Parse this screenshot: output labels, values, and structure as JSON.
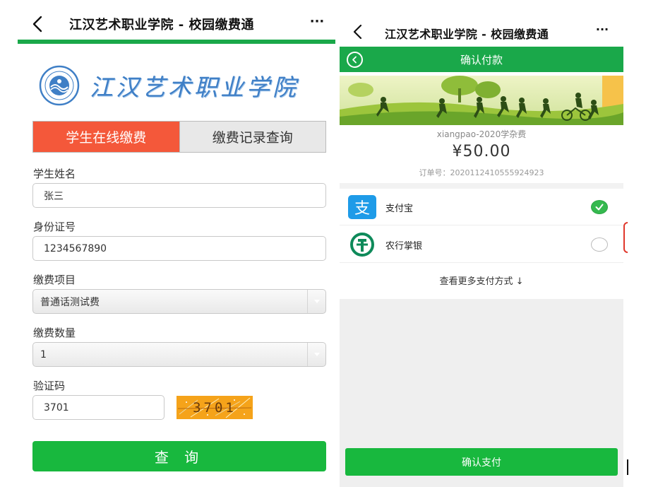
{
  "left": {
    "nav": {
      "title": "江汉艺术职业学院 - 校园缴费通",
      "more": "···"
    },
    "logo": {
      "text": "江汉艺术职业学院"
    },
    "tabs": [
      {
        "label": "学生在线缴费",
        "active": true
      },
      {
        "label": "缴费记录查询",
        "active": false
      }
    ],
    "form": {
      "name_label": "学生姓名",
      "name_value": "张三",
      "id_label": "身份证号",
      "id_value": "1234567890",
      "item_label": "缴费项目",
      "item_value": "普通话测试费",
      "qty_label": "缴费数量",
      "qty_value": "1",
      "captcha_label": "验证码",
      "captcha_value": "3701",
      "captcha_image_text": "3701"
    },
    "query_button": "查 询",
    "colors": {
      "accent_green": "#1aa84a",
      "active_tab": "#f4583a",
      "button_green": "#18b83e",
      "captcha_bg": "#f5a31a"
    }
  },
  "right": {
    "nav": {
      "title": "江汉艺术职业学院 - 校园缴费通",
      "more": "···"
    },
    "header_title": "确认付款",
    "order": {
      "name": "xiangpao-2020学杂费",
      "amount": "¥50.00",
      "order_no_label": "订单号：",
      "order_no": "202011241055592492​3"
    },
    "payment_methods": [
      {
        "label": "支付宝",
        "icon": "alipay-icon",
        "selected": true
      },
      {
        "label": "农行掌银",
        "icon": "abc-bank-icon",
        "selected": false
      }
    ],
    "more_methods": "查看更多支付方式 ↓",
    "confirm_button": "确认支付",
    "colors": {
      "header_green": "#1aa84a",
      "alipay_blue": "#1e9be8",
      "abc_green": "#0e8a5a",
      "radio_green": "#35b94f"
    }
  }
}
